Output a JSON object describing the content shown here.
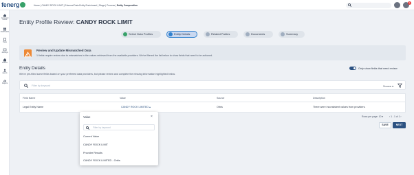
{
  "brand": {
    "logo_text": "fenerg",
    "accent": "#2c5282",
    "green": "#38a169",
    "alert": "#ed8936"
  },
  "sidebar": {
    "items": [
      {
        "label": "Command Centre",
        "icon": "home-icon"
      },
      {
        "label": "Dashboards",
        "icon": "dashboard-icon"
      },
      {
        "label": "Tasks",
        "icon": "tasks-icon"
      },
      {
        "label": "Journeys",
        "icon": "journeys-icon"
      },
      {
        "label": "Entities",
        "icon": "entities-icon"
      },
      {
        "label": "Agents",
        "icon": "agents-icon"
      },
      {
        "label": "Reports",
        "icon": "reports-icon"
      }
    ]
  },
  "topbar": {
    "breadcrumb": [
      "Home",
      "CANDY ROCK LIMIT",
      "External Data Entity Enrichment",
      "Stage | Process",
      "Entity Composition"
    ],
    "notifications": "1"
  },
  "page": {
    "title_prefix": "Entity Profile Review:",
    "title_entity": "CANDY ROCK LIMIT"
  },
  "steps": [
    {
      "label": "Select Data Profiles",
      "state": "done"
    },
    {
      "label": "Entity Details",
      "state": "active"
    },
    {
      "label": "Related Parties",
      "state": "pending"
    },
    {
      "label": "Documents",
      "state": "pending"
    },
    {
      "label": "Summary",
      "state": "pending"
    }
  ],
  "alert": {
    "title": "Review and Update Mismatched Data",
    "text": "1 fields require review due to mismatches in the values retrieved from the available providers. We've filtered the list below to show fields that need to be actioned."
  },
  "details": {
    "title": "Entity Details",
    "description": "We've pre-filled some fields based on your preferred data providers, but please review and complete the missing information highlighted below.",
    "toggle_label": "Only show fields that need review",
    "toggle_on": true
  },
  "filter": {
    "placeholder": "Filter by keyword",
    "source_label": "Source"
  },
  "table": {
    "headers": [
      "Field Name",
      "Value",
      "Source",
      "Description"
    ],
    "rows": [
      {
        "field": "Legal Entity Name",
        "value": "CANDY ROCK LIMITED",
        "source": "Orbis",
        "description": "There were inconsistent values from providers."
      }
    ]
  },
  "pager": {
    "rows_per_page": "Rows per page: 10",
    "range": "1 - 1 of 1"
  },
  "actions": {
    "save": "SAVE",
    "next": "NEXT"
  },
  "popup": {
    "title": "Value",
    "search_placeholder": "Filter by keyword",
    "current_header": "Current Value",
    "current_value": "CANDY ROCK LIMIT",
    "provider_header": "Provider Results",
    "provider_value": "CANDY ROCK LIMITED - Orbis"
  }
}
